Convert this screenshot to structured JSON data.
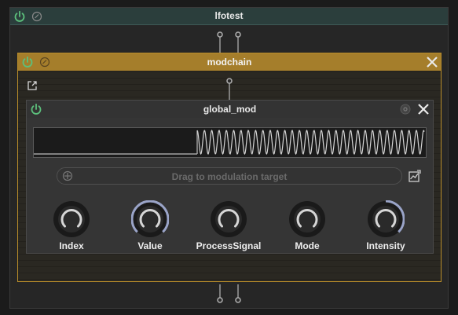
{
  "outer_panel": {
    "title": "lfotest"
  },
  "modchain_panel": {
    "title": "modchain"
  },
  "global_mod_panel": {
    "title": "global_mod",
    "drag_target_label": "Drag to modulation target",
    "knobs": [
      {
        "label": "Index",
        "value": 0.0
      },
      {
        "label": "Value",
        "value": 1.0
      },
      {
        "label": "ProcessSignal",
        "value": 0.0
      },
      {
        "label": "Mode",
        "value": 0.0
      },
      {
        "label": "Intensity",
        "value": 0.65
      }
    ]
  },
  "colors": {
    "power_on": "#5cc07c",
    "outer_header": "#2b3e3c",
    "modchain_header": "#a57e2b",
    "knob_arc": "#9aa4c8"
  },
  "icons": {
    "power": "power-icon",
    "bypass": "bypass-icon",
    "close": "close-icon",
    "popout": "popout-icon",
    "modulation_target": "crosshair-icon",
    "add_modulation": "add-modulation-icon"
  }
}
